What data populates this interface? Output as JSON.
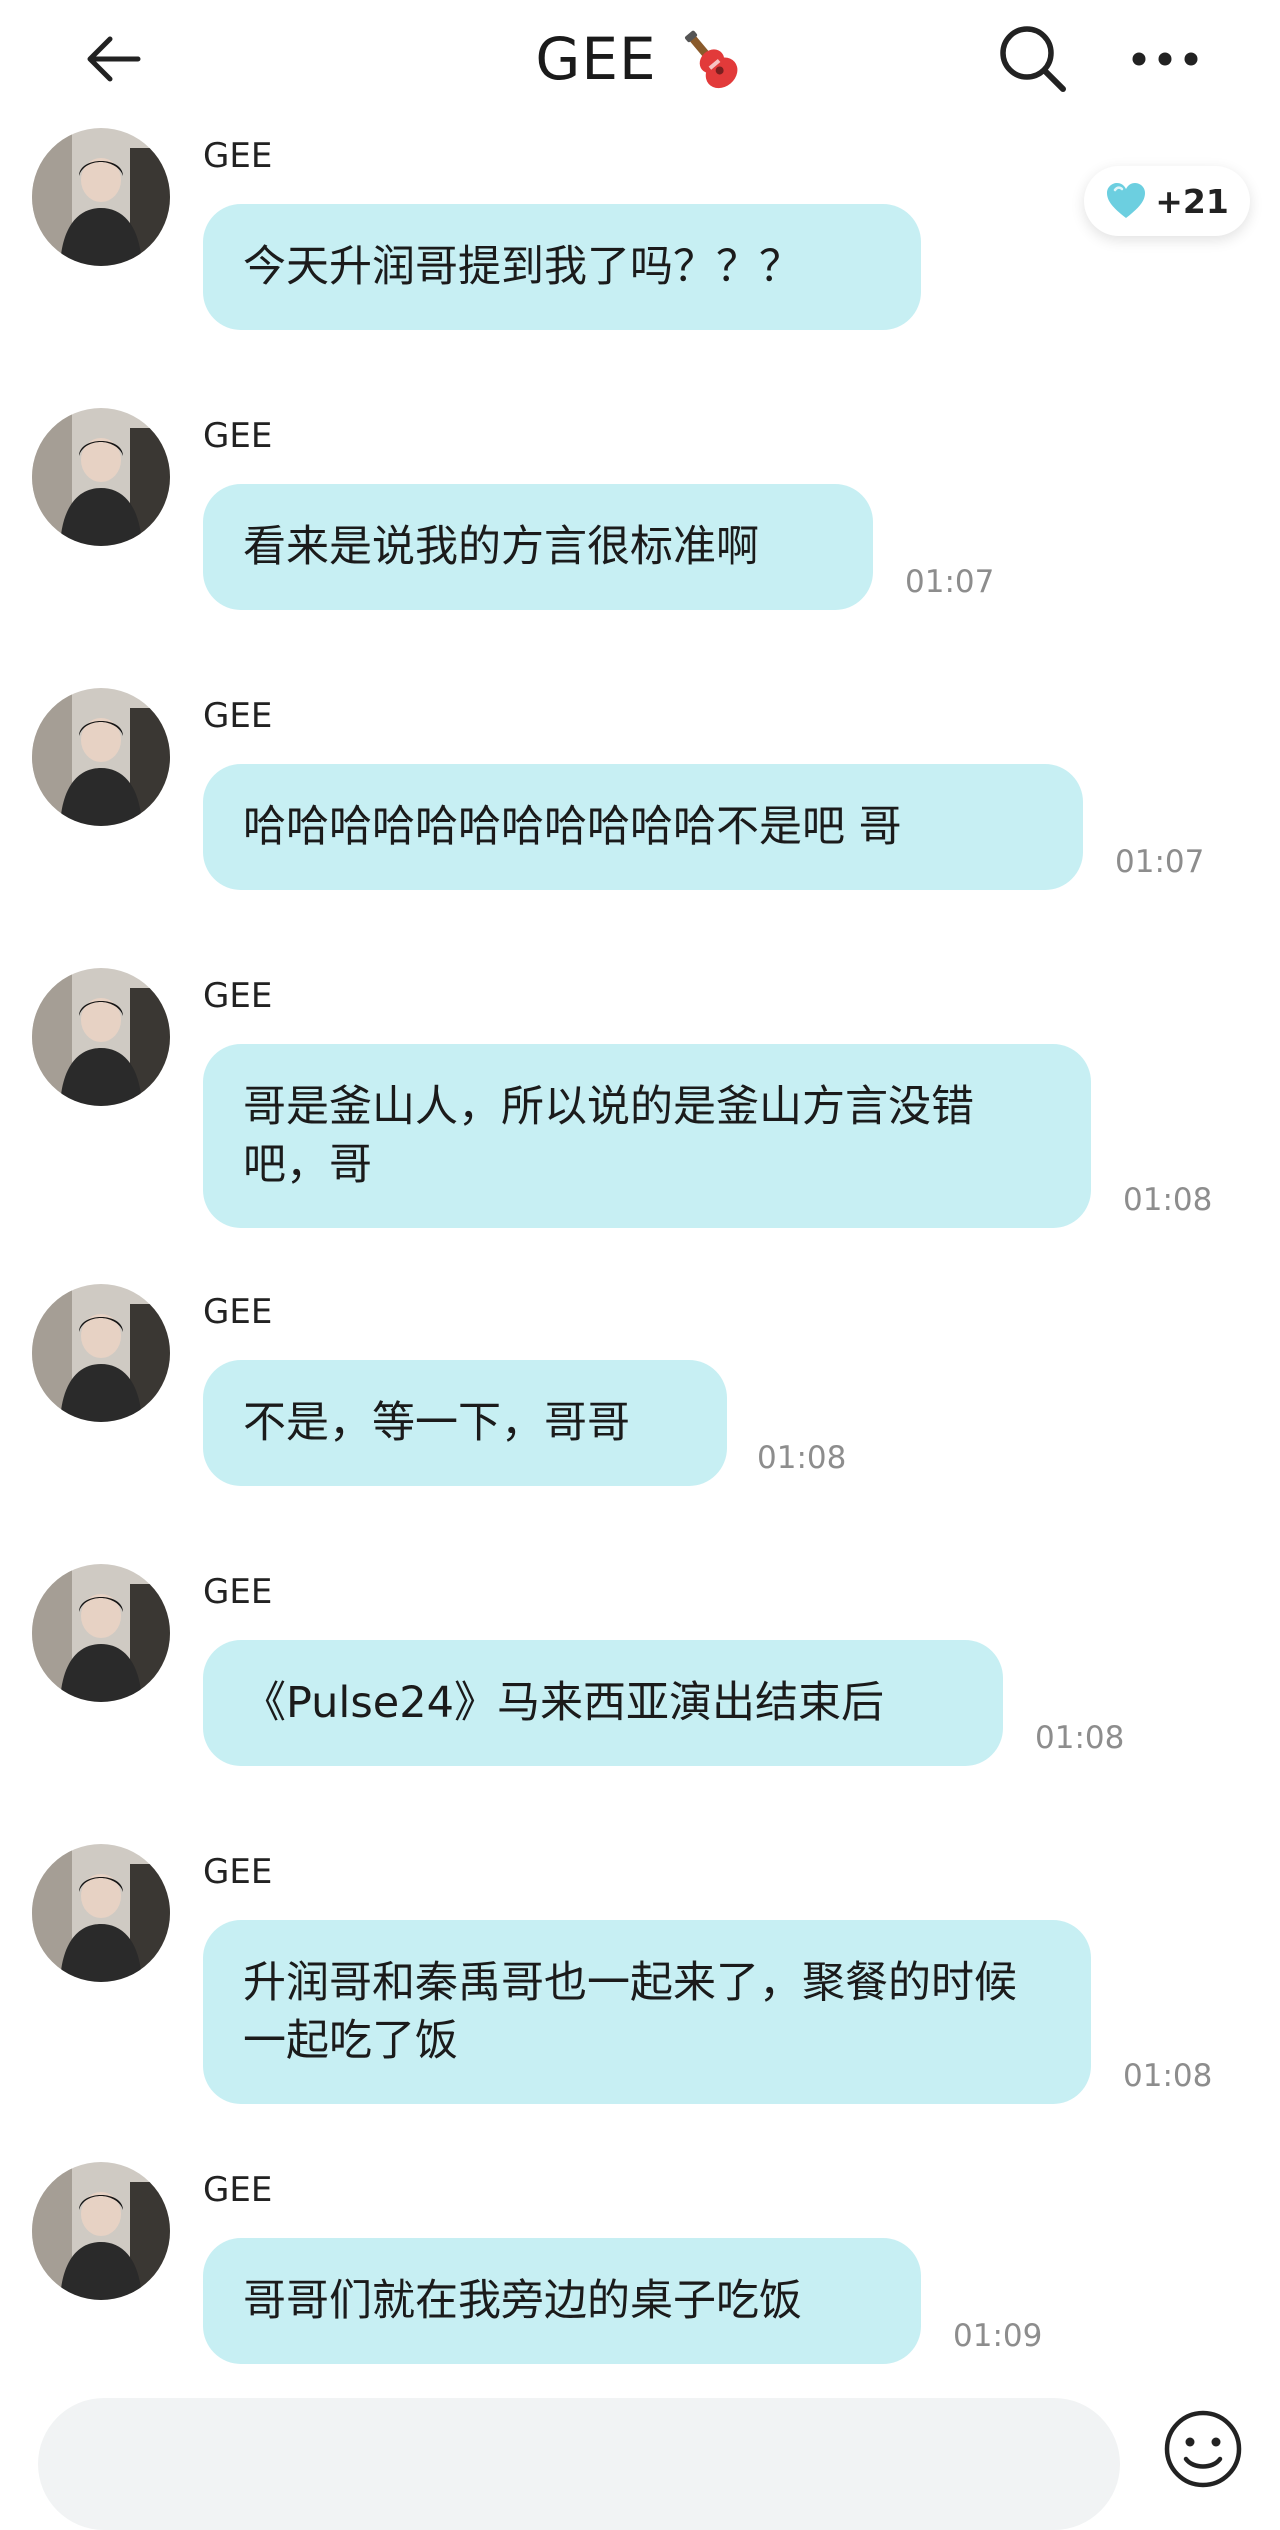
{
  "header": {
    "title": "GEE",
    "icons": {
      "back": "back-arrow-icon",
      "title_emoji": "guitar-icon",
      "search": "search-icon",
      "more": "more-icon"
    }
  },
  "reaction": {
    "icon": "heart-icon",
    "count": "+21",
    "color": "#6ccfe0"
  },
  "messages": [
    {
      "sender": "GEE",
      "text": "今天升润哥提到我了吗？？？",
      "time": ""
    },
    {
      "sender": "GEE",
      "text": "看来是说我的方言很标准啊",
      "time": "01:07"
    },
    {
      "sender": "GEE",
      "text": "哈哈哈哈哈哈哈哈哈哈哈不是吧 哥",
      "time": "01:07"
    },
    {
      "sender": "GEE",
      "text": "哥是釜山人，所以说的是釜山方言没错吧，哥",
      "time": "01:08"
    },
    {
      "sender": "GEE",
      "text": "不是，等一下，哥哥",
      "time": "01:08"
    },
    {
      "sender": "GEE",
      "text": "《Pulse24》马来西亚演出结束后",
      "time": "01:08"
    },
    {
      "sender": "GEE",
      "text": "升润哥和秦禹哥也一起来了，聚餐的时候一起吃了饭",
      "time": "01:08"
    },
    {
      "sender": "GEE",
      "text": "哥哥们就在我旁边的桌子吃饭",
      "time": "01:09"
    }
  ],
  "input": {
    "placeholder": "",
    "emoji_icon": "smiley-icon"
  },
  "colors": {
    "bubble": "#c7eff3",
    "time": "#8d8d8d",
    "background": "#ffffff"
  }
}
